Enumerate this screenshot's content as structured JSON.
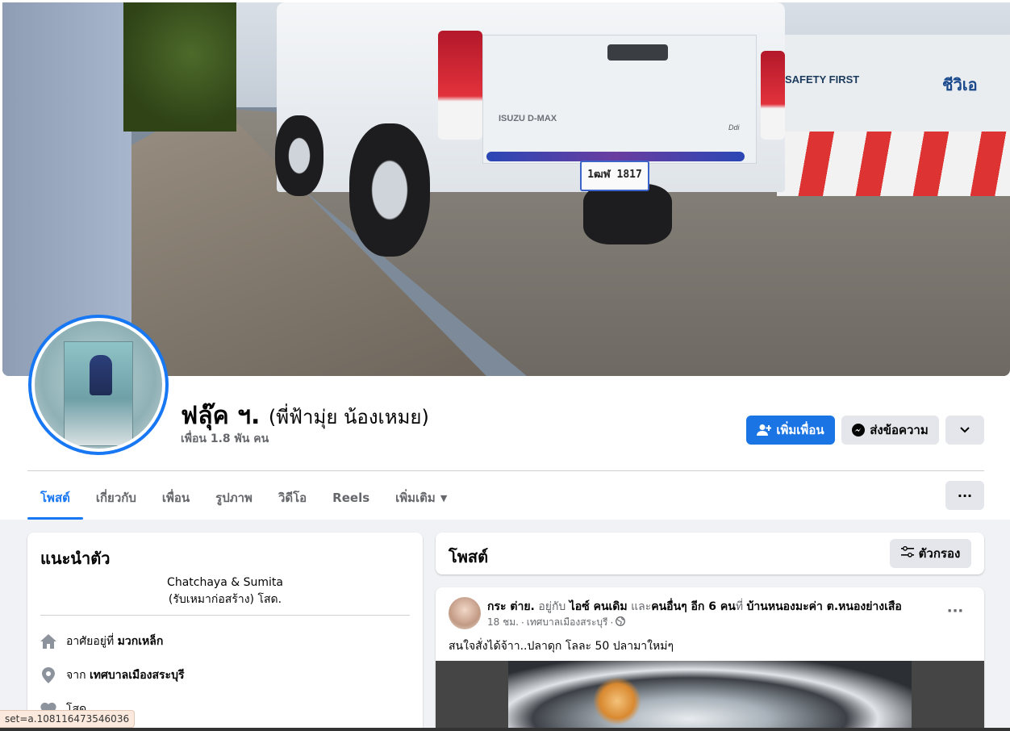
{
  "profile": {
    "name": "ฟลุ๊ค ฯ.",
    "alternate_name": "(พี่ฟ้ามุ่ย น้องเหมย)",
    "friends_count": "เพื่อน 1.8 พัน คน"
  },
  "cover": {
    "sign_safety": "SAFETY FIRST",
    "sign_brand": "ชีวิเอ",
    "truck_badge": "ISUZU D-MAX",
    "truck_badge_small": "Ddi",
    "plate": "1ฒฬ 1817"
  },
  "actions": {
    "add_friend": "เพิ่มเพื่อน",
    "message": "ส่งข้อความ"
  },
  "tabs": [
    {
      "label": "โพสต์"
    },
    {
      "label": "เกี่ยวกับ"
    },
    {
      "label": "เพื่อน"
    },
    {
      "label": "รูปภาพ"
    },
    {
      "label": "วิดีโอ"
    },
    {
      "label": "Reels"
    },
    {
      "label": "เพิ่มเติม"
    }
  ],
  "intro": {
    "title": "แนะนำตัว",
    "bio_line1": "Chatchaya & Sumita",
    "bio_line2": "(รับเหมาก่อสร้าง) โสด.",
    "lives_prefix": "อาศัยอยู่ที่",
    "lives_value": "มวกเหล็ก",
    "from_prefix": "จาก",
    "from_value": "เทศบาลเมืองสระบุรี",
    "relationship": "โสด"
  },
  "posts": {
    "title": "โพสต์",
    "filter_label": "ตัวกรอง"
  },
  "post": {
    "author": "กระ ต่าย.",
    "with_text": "อยู่กับ",
    "tagged": "ไอซ์ คนเดิม",
    "and_text": "และ",
    "others": "คนอื่นๆ อีก 6 คน",
    "at_text": "ที่",
    "place": "บ้านหนองมะค่า ต.หนองย่างเสือ",
    "time": "18 ชม.",
    "location": "เทศบาลเมืองสระบุรี",
    "text": "สนใจสั่งได้จ้าา..ปลาดุก โลละ 50 ปลามาใหม่ๆ"
  },
  "status_bar": {
    "url": "set=a.108116473546036"
  },
  "colors": {
    "accent": "#1877f2",
    "primary_button": "#1b74e4",
    "secondary_button": "#e4e6eb",
    "background": "#f0f2f5"
  }
}
